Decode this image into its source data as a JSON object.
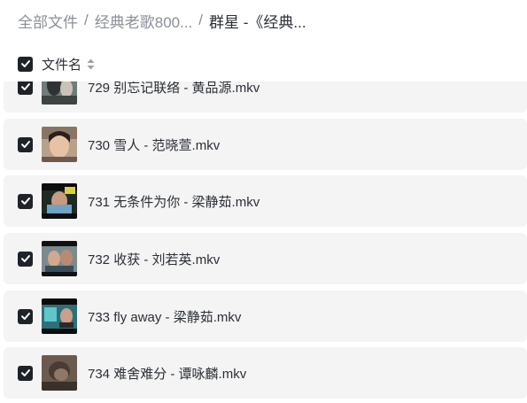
{
  "breadcrumb": {
    "items": [
      "全部文件",
      "经典老歌800...",
      "群星 -《经典..."
    ],
    "separator": "/"
  },
  "header": {
    "column_label": "文件名",
    "select_all_checked": true
  },
  "files": [
    {
      "name": "729 别忘记联络 - 黄品源.mkv",
      "checked": true
    },
    {
      "name": "730 雪人 - 范晓萱.mkv",
      "checked": true
    },
    {
      "name": "731 无条件为你 - 梁静茹.mkv",
      "checked": true
    },
    {
      "name": "732 收获 - 刘若英.mkv",
      "checked": true
    },
    {
      "name": "733 fly away - 梁静茹.mkv",
      "checked": true
    },
    {
      "name": "734 难舍难分 - 谭咏麟.mkv",
      "checked": true
    }
  ],
  "colors": {
    "checkbox": "#1f2329",
    "row_background": "#f4f4f5",
    "breadcrumb_muted": "#8a8f99"
  }
}
